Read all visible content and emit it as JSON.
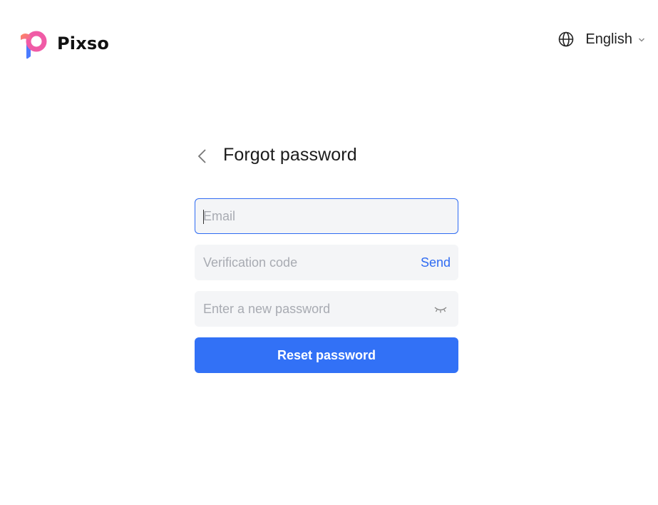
{
  "header": {
    "brand_name": "Pixso",
    "language_label": "English"
  },
  "form": {
    "title": "Forgot password",
    "email": {
      "placeholder": "Email",
      "value": ""
    },
    "verification_code": {
      "placeholder": "Verification code",
      "value": "",
      "send_label": "Send"
    },
    "new_password": {
      "placeholder": "Enter a new password",
      "value": ""
    },
    "submit_label": "Reset password"
  },
  "colors": {
    "accent": "#3271f6",
    "link": "#2f6bf2",
    "field_background": "#f4f5f7",
    "placeholder": "#a8abb2",
    "logo_pink": "#f05ba6",
    "logo_orange": "#ff8a5c",
    "logo_blue": "#4a7bff"
  },
  "icons": {
    "logo": "pixso-logo-icon",
    "language": "globe-icon",
    "language_dropdown": "chevron-down-icon",
    "back": "chevron-left-icon",
    "password_visibility": "eye-closed-icon"
  }
}
